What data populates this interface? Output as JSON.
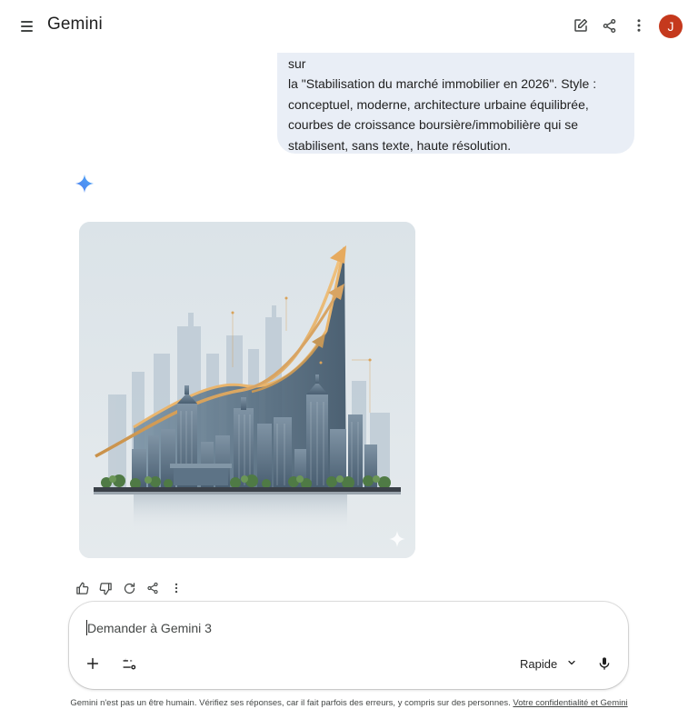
{
  "header": {
    "title": "Gemini",
    "avatar_letter": "J",
    "icons": [
      "menu-icon",
      "new-chat-icon",
      "share-icon",
      "more-vert-icon"
    ]
  },
  "user_message": {
    "lines": [
      "Génère une image illustrative professionnelle pour l'article sur",
      "la \"Stabilisation du marché immobilier en 2026\". Style :",
      "conceptuel, moderne, architecture urbaine équilibrée,",
      "courbes de croissance boursière/immobilière qui se",
      "stabilisent, sans texte, haute résolution."
    ]
  },
  "response": {
    "icon": "gemini-sparkle-icon",
    "image_alt": "Illustration: city skyline with rising growth arrows",
    "action_icons": [
      "thumbs-up-icon",
      "thumbs-down-icon",
      "redo-icon",
      "share-icon",
      "more-vert-icon"
    ]
  },
  "composer": {
    "placeholder": "Demander à Gemini 3",
    "value": "",
    "mode_label": "Rapide",
    "icons": [
      "add-icon",
      "tools-icon",
      "chevron-down-icon",
      "mic-icon"
    ]
  },
  "footer": {
    "text": "Gemini n'est pas un être humain. Vérifiez ses réponses, car il fait parfois des erreurs, y compris sur des personnes. ",
    "link_label": "Votre confidentialité et Gemini"
  },
  "colors": {
    "bubble": "#e9eef6",
    "avatar": "#c5391d",
    "sparkle": "#4285f4",
    "arrow_gold": "#d9a35a",
    "building_blue": "#5b7184"
  }
}
